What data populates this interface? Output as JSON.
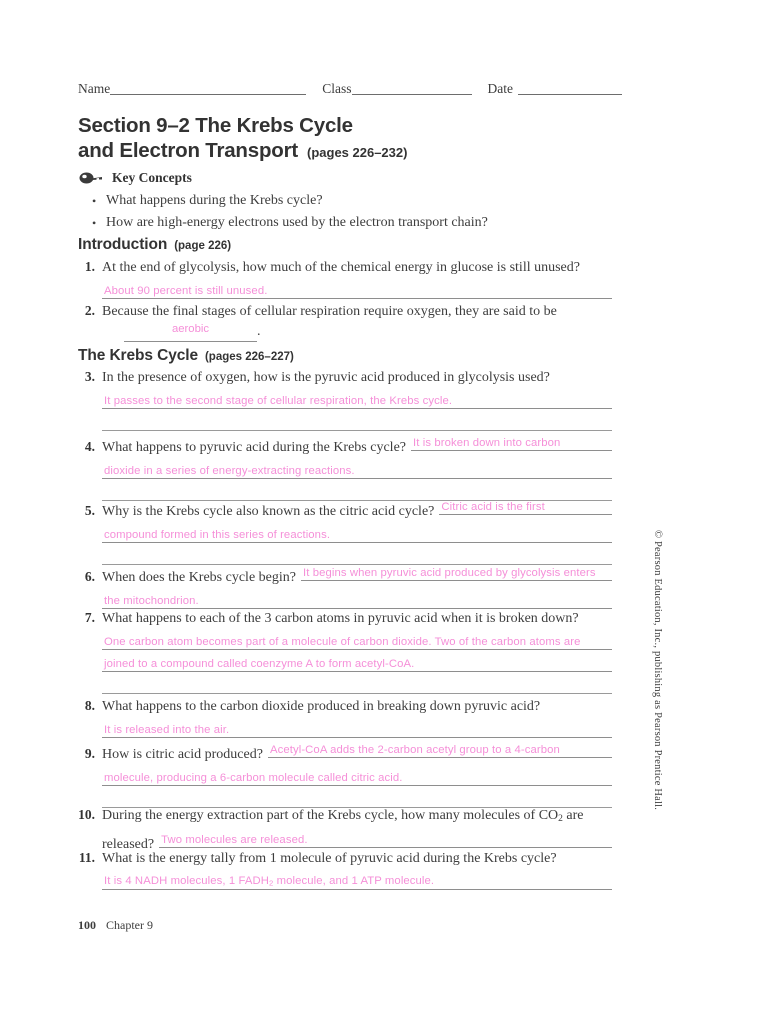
{
  "header": {
    "name_label": "Name",
    "class_label": "Class",
    "date_label": "Date"
  },
  "section": {
    "title_line1": "Section 9–2  The Krebs Cycle",
    "title_line2": "and Electron Transport",
    "pages": "(pages 226–232)"
  },
  "key_concepts": {
    "icon": "key-icon",
    "label": "Key Concepts",
    "bullets": [
      "What happens during the Krebs cycle?",
      "How are high-energy electrons used by the electron transport chain?"
    ]
  },
  "introduction": {
    "heading": "Introduction",
    "pages": "(page 226)",
    "questions": [
      {
        "number": "1.",
        "text": "At the end of glycolysis, how much of the chemical energy in glucose is still unused?",
        "answer_lines": [
          "About 90 percent is still unused."
        ]
      },
      {
        "number": "2.",
        "text": "Because the final stages of cellular respiration require oxygen, they are said to be",
        "blank_answer": "aerobic",
        "trailing": "."
      }
    ]
  },
  "krebs_cycle": {
    "heading": "The Krebs Cycle",
    "pages": "(pages 226–227)",
    "questions": [
      {
        "number": "3.",
        "text": "In the presence of oxygen, how is the pyruvic acid produced in glycolysis used?",
        "answer_lines": [
          "It passes to the second stage of cellular respiration, the Krebs cycle.",
          ""
        ]
      },
      {
        "number": "4.",
        "text": "What happens to pyruvic acid during the Krebs cycle?",
        "inline_answer": "It is broken down into carbon",
        "answer_lines": [
          "dioxide in a series of energy-extracting reactions.",
          ""
        ]
      },
      {
        "number": "5.",
        "text": "Why is the Krebs cycle also known as the citric acid cycle?",
        "inline_answer": "Citric acid is the first",
        "answer_lines": [
          "compound formed in this series of reactions.",
          ""
        ]
      },
      {
        "number": "6.",
        "text": "When does the Krebs cycle begin?",
        "inline_answer": "It begins when pyruvic acid produced by glycolysis enters",
        "answer_lines": [
          "the mitochondrion."
        ]
      },
      {
        "number": "7.",
        "text": "What happens to each of the 3 carbon atoms in pyruvic acid when it is broken down?",
        "answer_lines": [
          "One carbon atom becomes part of a molecule of carbon dioxide. Two of the carbon atoms are",
          "joined to a compound called coenzyme A to form acetyl-CoA.",
          ""
        ]
      },
      {
        "number": "8.",
        "text": "What happens to the carbon dioxide produced in breaking down pyruvic acid?",
        "answer_lines": [
          "It is released into the air."
        ]
      },
      {
        "number": "9.",
        "text": "How is citric acid produced?",
        "inline_answer": "Acetyl-CoA adds the 2-carbon acetyl group to a 4-carbon",
        "answer_lines": [
          "molecule, producing a 6-carbon molecule called citric acid.",
          ""
        ]
      },
      {
        "number": "10.",
        "text_part1": "During the energy extraction part of the Krebs cycle, how many molecules of CO",
        "text_subscript": "2",
        "text_part2": " are",
        "text_line2": "released?",
        "inline_answer": "Two molecules are released."
      },
      {
        "number": "11.",
        "text": "What is the energy tally from 1 molecule of pyruvic acid during the Krebs cycle?",
        "answer_line_part1": "It is 4 NADH molecules, 1 FADH",
        "answer_line_subscript": "2",
        "answer_line_part2": " molecule, and 1 ATP molecule."
      }
    ]
  },
  "copyright": "© Pearson Education, Inc., publishing as Pearson Prentice Hall.",
  "footer": {
    "page_number": "100",
    "chapter": "Chapter 9"
  },
  "colors": {
    "answer_pink": "#f58fd8",
    "rule_gray": "#8e8e8e",
    "text_gray": "#3d3d3d"
  }
}
